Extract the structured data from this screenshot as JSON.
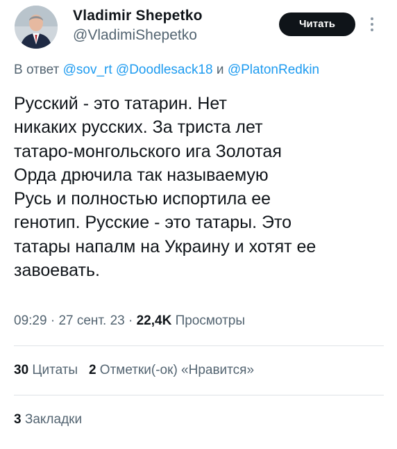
{
  "author": {
    "display_name": "Vladimir Shepetko",
    "handle": "@VladimiShepetko"
  },
  "follow_button_label": "Читать",
  "reply_context": {
    "prefix": "В ответ",
    "mention_1": "@sov_rt",
    "mention_2": "@Doodlesack18",
    "conjunction": "и",
    "mention_3": "@PlatonRedkin"
  },
  "tweet_lines": [
    "Русский - это татарин. Нет",
    "никаких русских. За триста лет",
    "татаро-монгольского ига Золотая",
    "Орда дрючила так называемую",
    "Русь и полностью испортила ее",
    "генотип. Русские - это татары. Это",
    "татары напалм на Украину и хотят ее",
    "завоевать."
  ],
  "meta": {
    "time": "09:29",
    "separator": "·",
    "date": "27 сент. 23",
    "views_count": "22,4K",
    "views_label": "Просмотры"
  },
  "stats": {
    "quotes_count": "30",
    "quotes_label": "Цитаты",
    "likes_count": "2",
    "likes_label": "Отметки(-ок) «Нравится»"
  },
  "bookmarks": {
    "count": "3",
    "label": "Закладки"
  },
  "icons": {
    "more": "more-vertical-icon"
  },
  "colors": {
    "accent": "#1d9bf0",
    "secondary_text": "#536471",
    "primary_text": "#0f1419",
    "button_bg": "#0f1419"
  }
}
